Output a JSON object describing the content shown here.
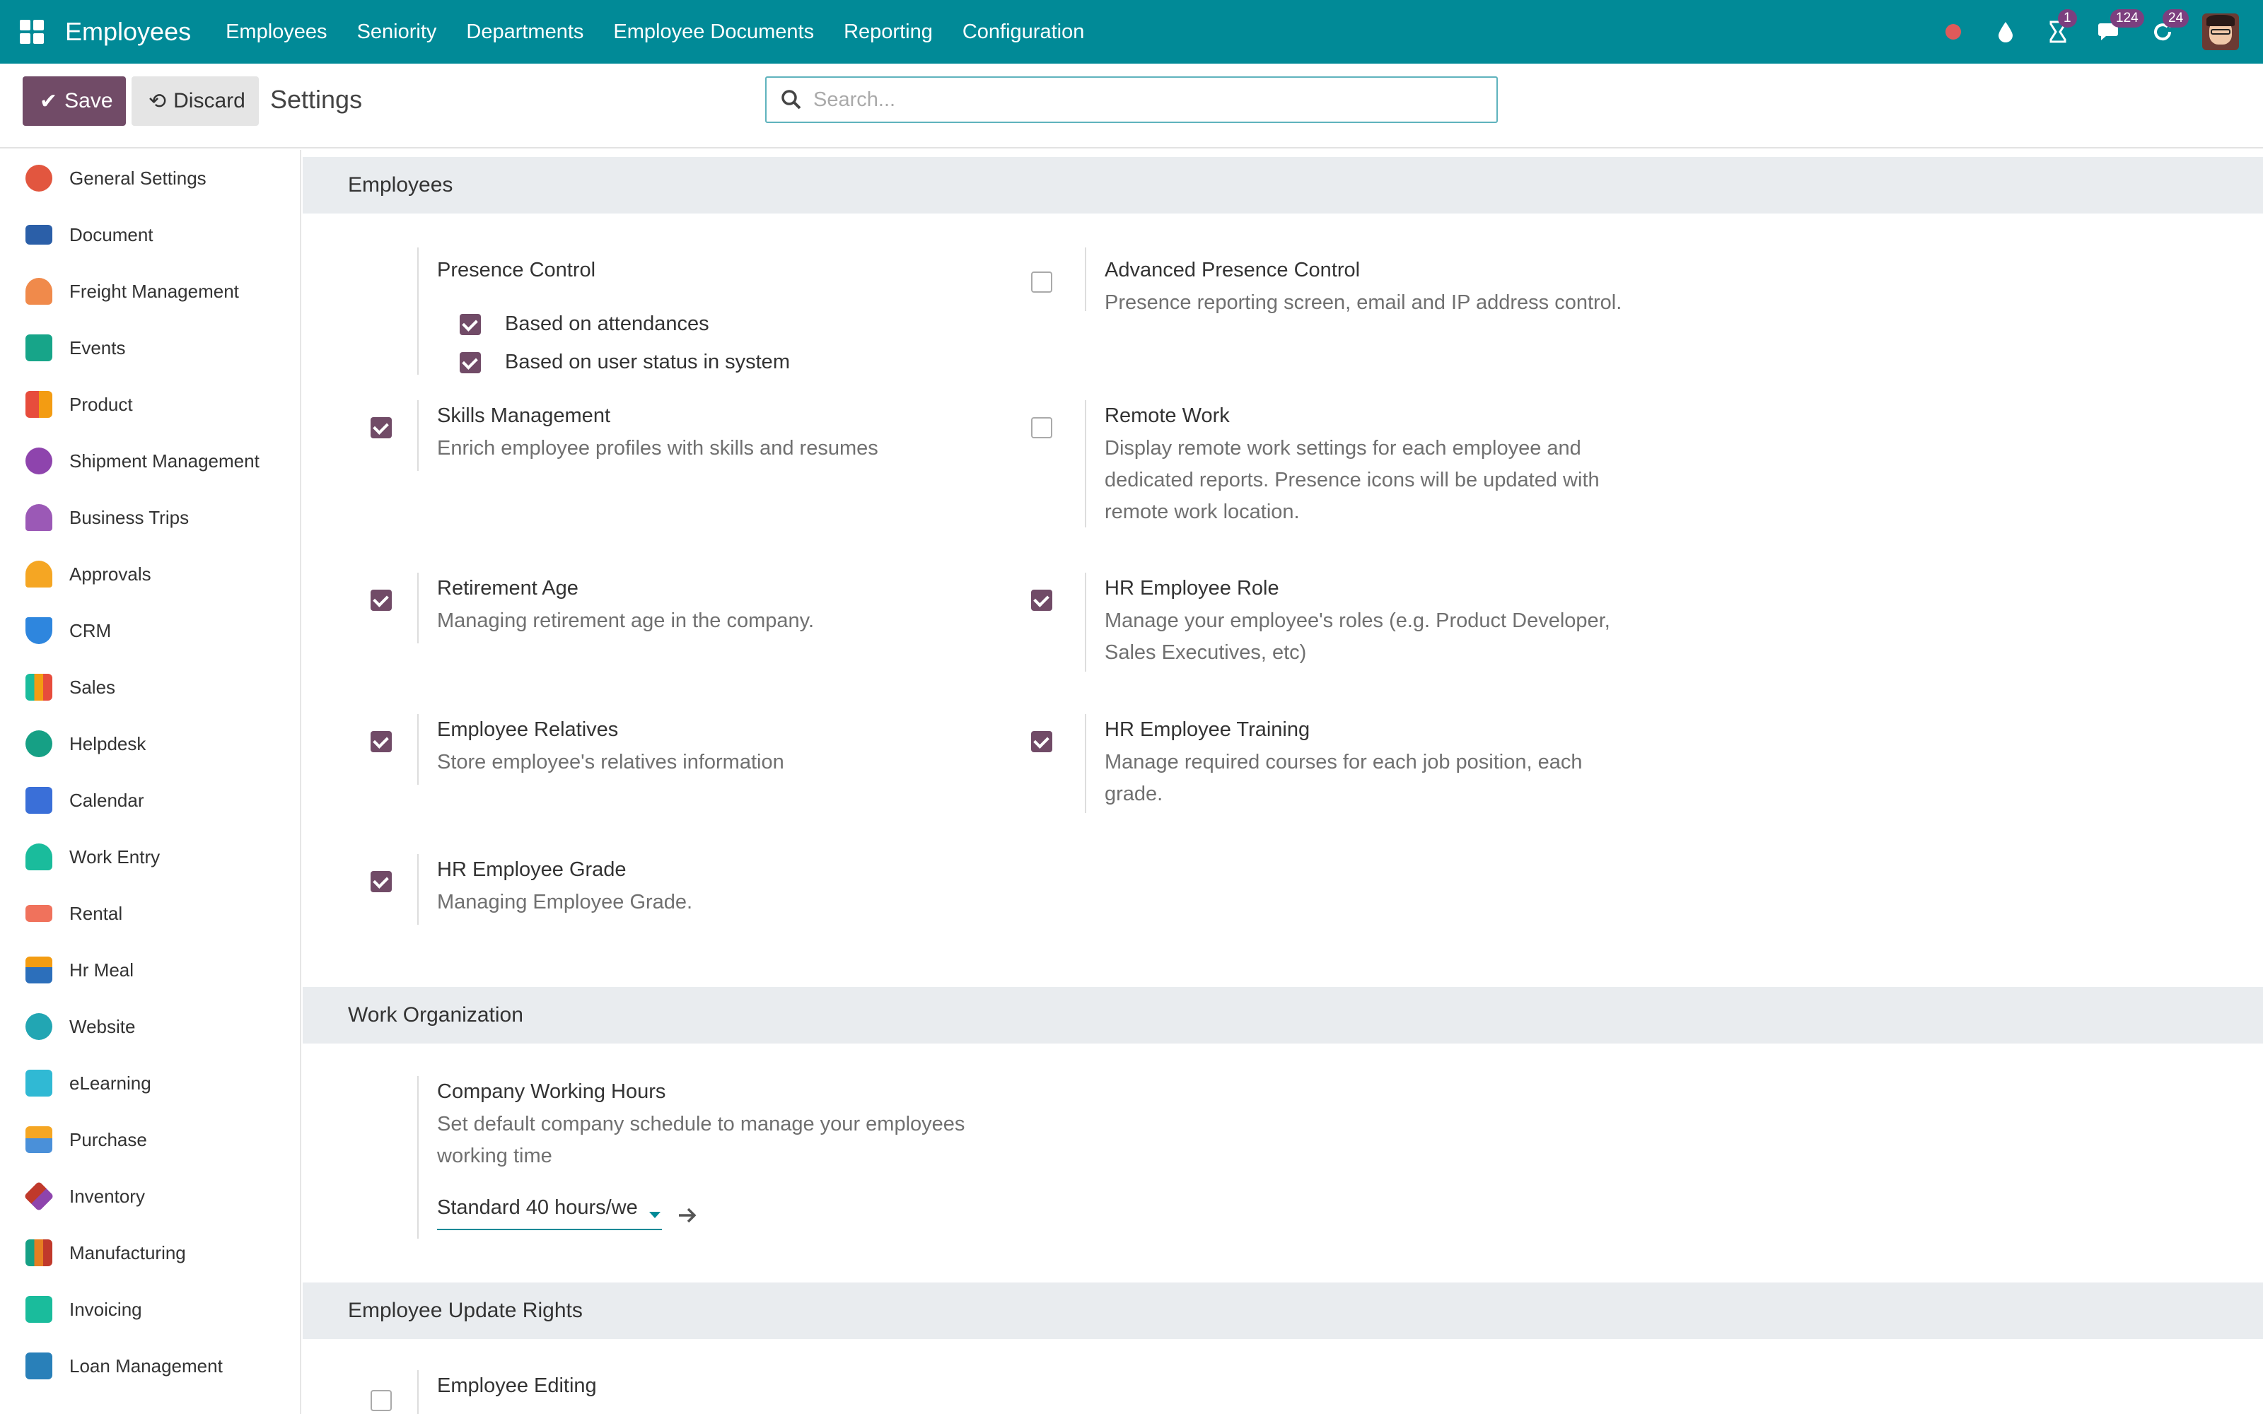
{
  "navbar": {
    "brand": "Employees",
    "menu": [
      "Employees",
      "Seniority",
      "Departments",
      "Employee Documents",
      "Reporting",
      "Configuration"
    ],
    "badges": {
      "activities": "1",
      "messages": "124",
      "updates": "24"
    }
  },
  "control": {
    "save_label": "Save",
    "discard_label": "Discard",
    "title": "Settings",
    "search_placeholder": "Search..."
  },
  "sidebar": {
    "items": [
      {
        "label": "General Settings",
        "color": "#e2563f"
      },
      {
        "label": "Document",
        "color": "#2b5fa8"
      },
      {
        "label": "Freight Management",
        "color": "#f08a4b"
      },
      {
        "label": "Events",
        "color": "#17a589"
      },
      {
        "label": "Product",
        "color": "#e74c3c"
      },
      {
        "label": "Shipment Management",
        "color": "#8e44ad"
      },
      {
        "label": "Business Trips",
        "color": "#9b59b6"
      },
      {
        "label": "Approvals",
        "color": "#f5a623"
      },
      {
        "label": "CRM",
        "color": "#2e86de"
      },
      {
        "label": "Sales",
        "color": "#f39c12"
      },
      {
        "label": "Helpdesk",
        "color": "#16a085"
      },
      {
        "label": "Calendar",
        "color": "#3a6fd8"
      },
      {
        "label": "Work Entry",
        "color": "#1abc9c"
      },
      {
        "label": "Rental",
        "color": "#f0725c"
      },
      {
        "label": "Hr Meal",
        "color": "#2c6fbb"
      },
      {
        "label": "Website",
        "color": "#22a6b3"
      },
      {
        "label": "eLearning",
        "color": "#30b9d4"
      },
      {
        "label": "Purchase",
        "color": "#4a90d9"
      },
      {
        "label": "Inventory",
        "color": "#c0392b"
      },
      {
        "label": "Manufacturing",
        "color": "#e67e22"
      },
      {
        "label": "Invoicing",
        "color": "#1abc9c"
      },
      {
        "label": "Loan Management",
        "color": "#2980b9"
      }
    ]
  },
  "sections": {
    "employees": "Employees",
    "work_org": "Work Organization",
    "update_rights": "Employee Update Rights"
  },
  "settings": {
    "presence_control": {
      "title": "Presence Control",
      "opt1": "Based on attendances",
      "opt2": "Based on user status in system"
    },
    "advanced_presence": {
      "title": "Advanced Presence Control",
      "desc": "Presence reporting screen, email and IP address control."
    },
    "skills": {
      "title": "Skills Management",
      "desc": "Enrich employee profiles with skills and resumes"
    },
    "remote_work": {
      "title": "Remote Work",
      "desc": "Display remote work settings for each employee and dedicated reports. Presence icons will be updated with remote work location."
    },
    "retirement": {
      "title": "Retirement Age",
      "desc": "Managing retirement age in the company."
    },
    "hr_role": {
      "title": "HR Employee Role",
      "desc": "Manage your employee's roles (e.g. Product Developer, Sales Executives, etc)"
    },
    "relatives": {
      "title": "Employee Relatives",
      "desc": "Store employee's relatives information"
    },
    "training": {
      "title": "HR Employee Training",
      "desc": "Manage required courses for each job position, each grade."
    },
    "grade": {
      "title": "HR Employee Grade",
      "desc": "Managing Employee Grade."
    },
    "working_hours": {
      "title": "Company Working Hours",
      "desc": "Set default company schedule to manage your employees working time",
      "value": "Standard 40 hours/we"
    },
    "editing": {
      "title": "Employee Editing"
    }
  },
  "colors": {
    "navbar": "#018a97",
    "primary": "#714b67"
  }
}
